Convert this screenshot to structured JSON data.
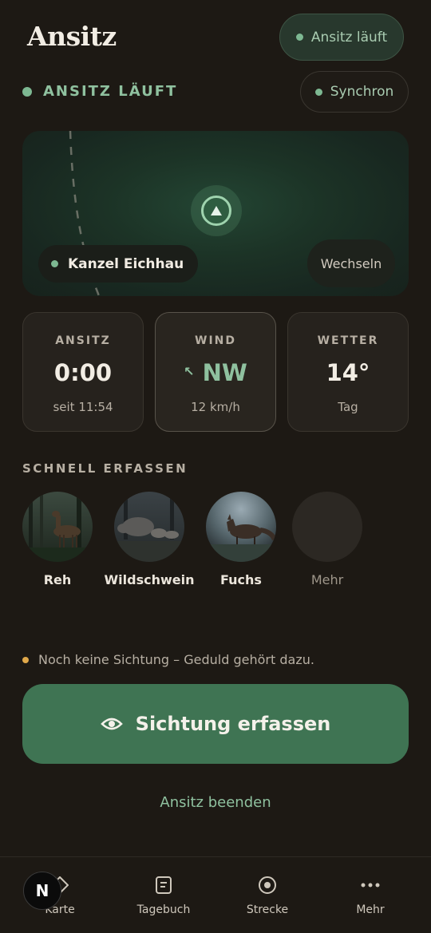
{
  "header": {
    "title": "Ansitz",
    "status_pill": "Ansitz läuft"
  },
  "status_row": {
    "live_label": "ANSITZ LÄUFT",
    "sync_label": "Synchron"
  },
  "map": {
    "stand_name": "Kanzel Eichhau",
    "switch_label": "Wechseln"
  },
  "stats": [
    {
      "title": "ANSITZ",
      "value": "0:00",
      "sub": "seit 11:54"
    },
    {
      "title": "WIND",
      "arrow": "↖",
      "value": "NW",
      "sub": "12 km/h"
    },
    {
      "title": "WETTER",
      "value": "14°",
      "sub": "Tag"
    }
  ],
  "quick_capture": {
    "label": "SCHNELL ERFASSEN",
    "species": [
      "Reh",
      "Wildschwein",
      "Fuchs"
    ],
    "more_label": "Mehr"
  },
  "hint": "Noch keine Sichtung – Geduld gehört dazu.",
  "cta_label": "Sichtung erfassen",
  "end_label": "Ansitz beenden",
  "nav": {
    "items": [
      "Karte",
      "Tagebuch",
      "Strecke",
      "Mehr"
    ]
  },
  "badge_letter": "N",
  "colors": {
    "background": "#1d1914",
    "accent_green": "#8fc19f",
    "cta_green": "#3f7453",
    "hint_dot": "#e0a84a"
  }
}
